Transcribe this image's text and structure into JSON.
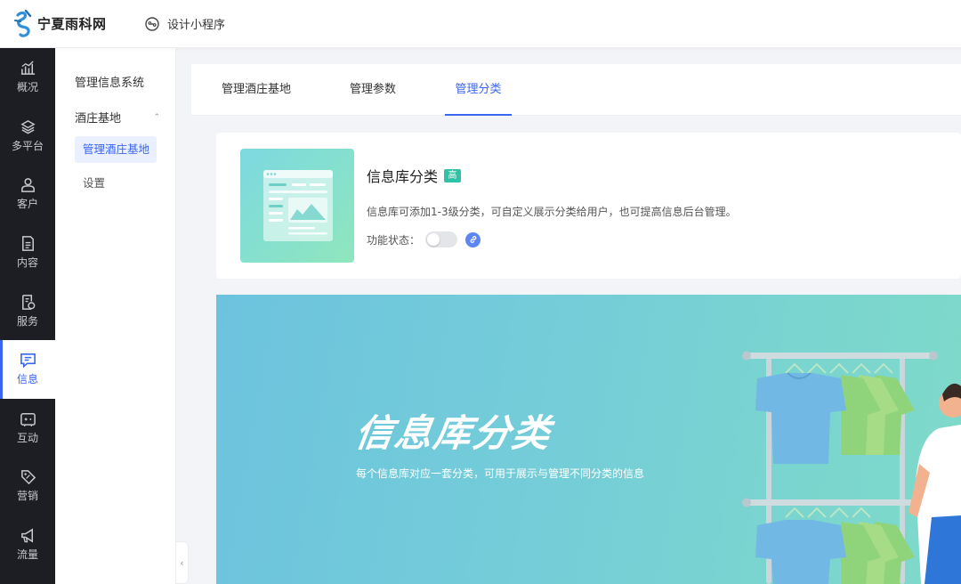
{
  "header": {
    "logo_text": "宁夏雨科网",
    "link_label": "设计小程序",
    "link_icon": "mini-program-icon"
  },
  "sidenav": {
    "items": [
      {
        "label": "概况",
        "icon": "chart-icon"
      },
      {
        "label": "多平台",
        "icon": "layers-icon"
      },
      {
        "label": "客户",
        "icon": "user-icon"
      },
      {
        "label": "内容",
        "icon": "document-icon"
      },
      {
        "label": "服务",
        "icon": "service-icon"
      },
      {
        "label": "信息",
        "icon": "message-icon",
        "active": true
      },
      {
        "label": "互动",
        "icon": "gamepad-icon"
      },
      {
        "label": "营销",
        "icon": "tag-icon"
      },
      {
        "label": "流量",
        "icon": "megaphone-icon"
      }
    ],
    "accent": "#3a66f0"
  },
  "subnav": {
    "title": "管理信息系统",
    "group": "酒庄基地",
    "items": [
      {
        "label": "管理酒庄基地",
        "active": true
      },
      {
        "label": "设置"
      }
    ]
  },
  "tabs": [
    {
      "label": "管理酒庄基地"
    },
    {
      "label": "管理参数"
    },
    {
      "label": "管理分类",
      "active": true
    }
  ],
  "feature": {
    "title": "信息库分类",
    "badge": "高",
    "description": "信息库可添加1-3级分类，可自定义展示分类给用户，也可提高信息后台管理。",
    "status_label": "功能状态：",
    "enabled": false
  },
  "banner": {
    "title": "信息库分类",
    "subtitle": "每个信息库对应一套分类，可用于展示与管理不同分类的信息"
  }
}
